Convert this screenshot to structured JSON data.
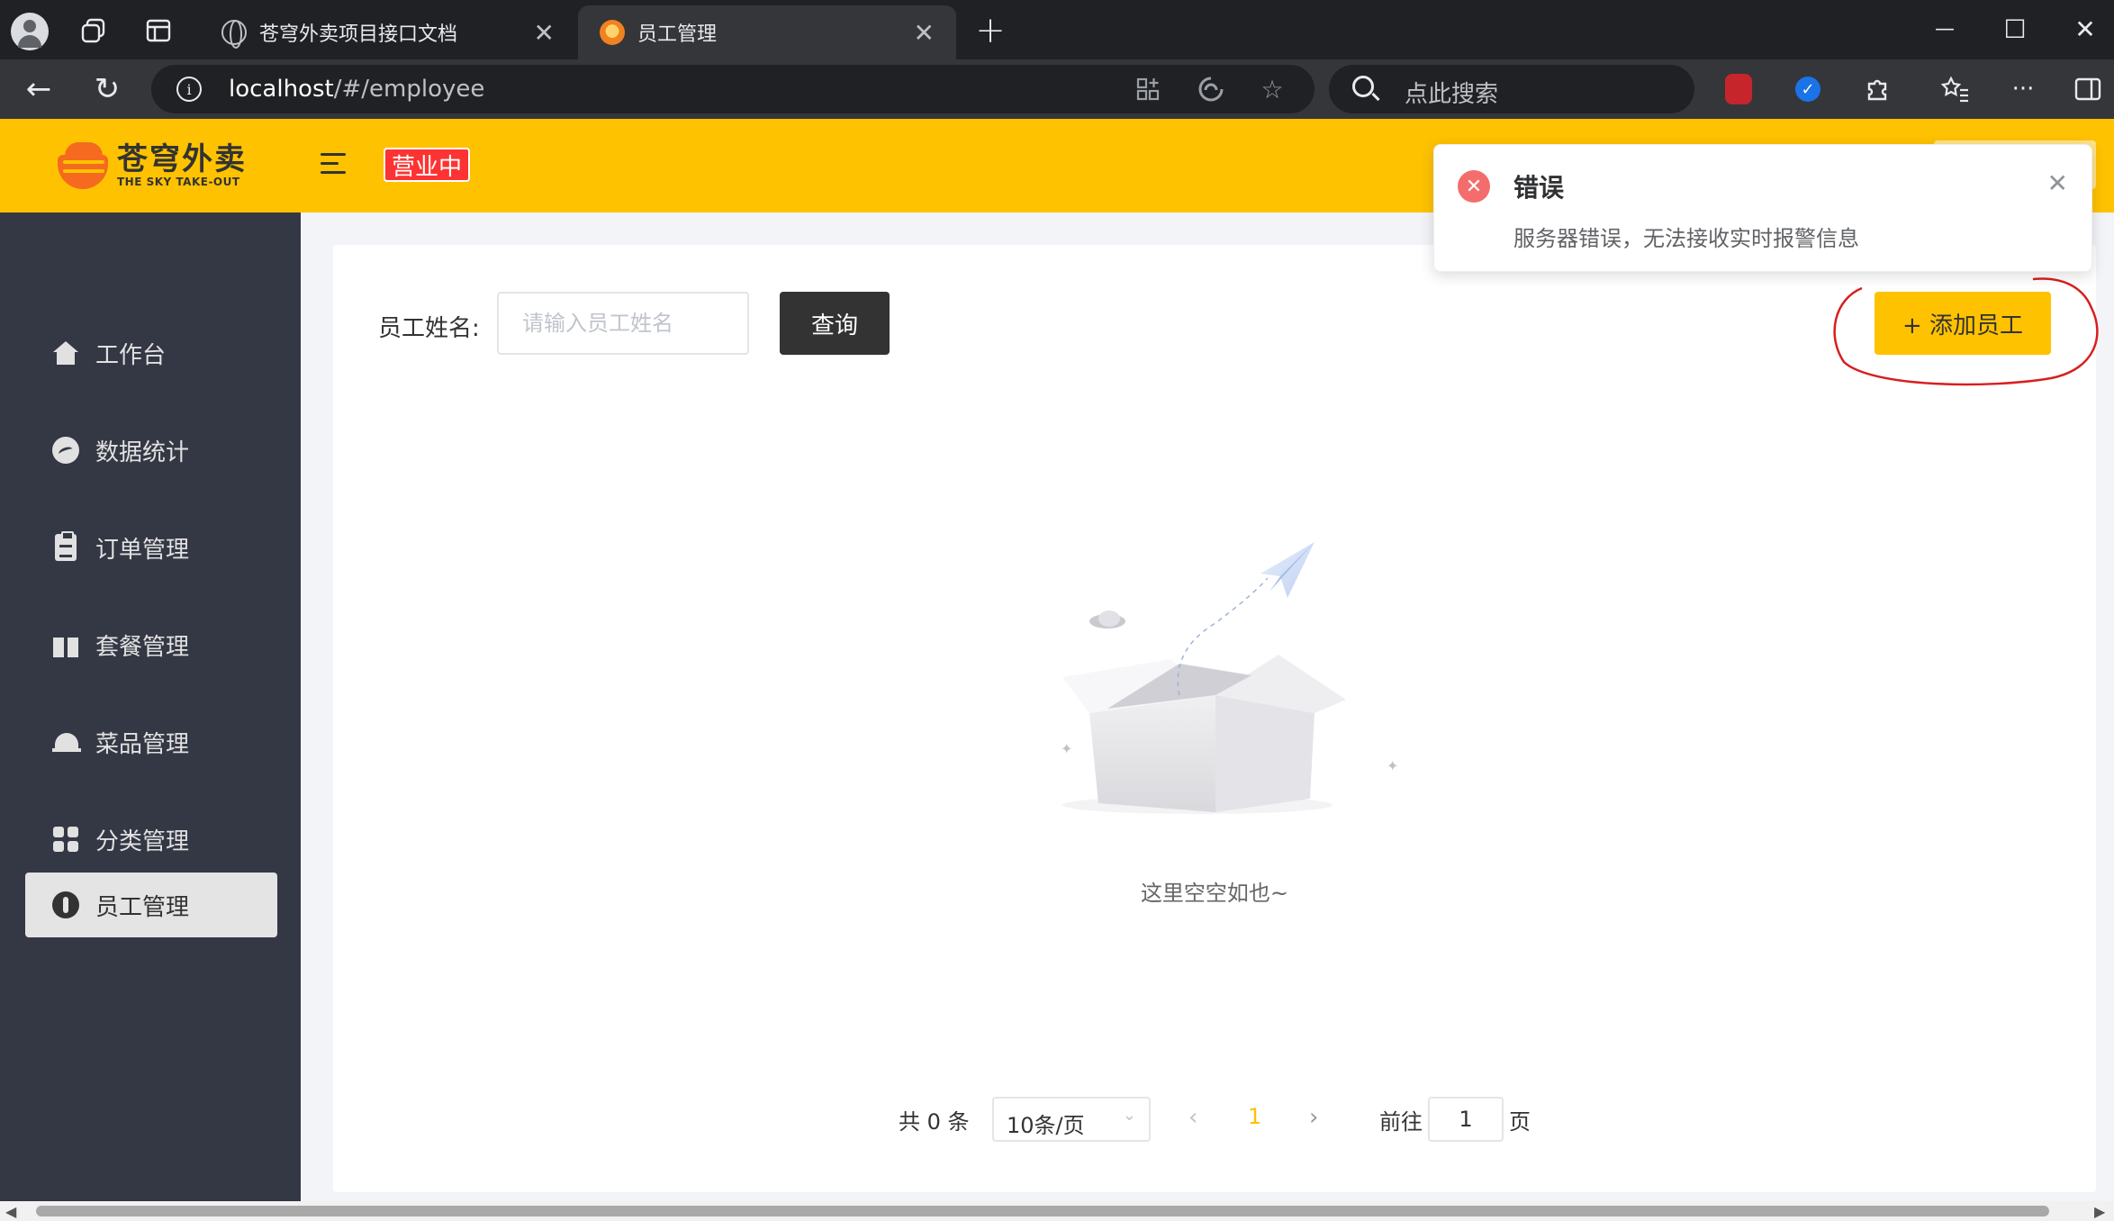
{
  "browser": {
    "tabs": [
      {
        "title": "苍穹外卖项目接口文档",
        "active": false
      },
      {
        "title": "员工管理",
        "active": true
      }
    ],
    "url_host": "localhost",
    "url_path": "/#/employee",
    "search_placeholder": "点此搜索",
    "icons": {
      "new_tab": "+",
      "close": "✕",
      "back": "←",
      "reload": "↻",
      "minimize": "—",
      "maximize": "☐",
      "window_close": "✕",
      "favorites": "☆",
      "more": "···"
    }
  },
  "header": {
    "logo_cn": "苍穹外卖",
    "logo_en": "THE SKY TAKE-OUT",
    "status_tag": "营业中",
    "brand_color": "#ffc200",
    "status_color": "#fd3333"
  },
  "sidebar": {
    "items": [
      {
        "label": "工作台",
        "icon": "home-icon",
        "active": false
      },
      {
        "label": "数据统计",
        "icon": "chart-circle-icon",
        "active": false
      },
      {
        "label": "订单管理",
        "icon": "clipboard-icon",
        "active": false
      },
      {
        "label": "套餐管理",
        "icon": "gift-icon",
        "active": false
      },
      {
        "label": "菜品管理",
        "icon": "food-cover-icon",
        "active": false
      },
      {
        "label": "分类管理",
        "icon": "grid-icon",
        "active": false
      },
      {
        "label": "员工管理",
        "icon": "person-icon",
        "active": true
      }
    ]
  },
  "main": {
    "filter_label": "员工姓名:",
    "filter_placeholder": "请输入员工姓名",
    "query_button": "查询",
    "add_button": "+ 添加员工",
    "empty_text": "这里空空如也~"
  },
  "pagination": {
    "total_text": "共 0 条",
    "page_size": "10条/页",
    "prev": "‹",
    "current_page": "1",
    "next": "›",
    "goto_label": "前往",
    "goto_value": "1",
    "page_word": "页"
  },
  "notification": {
    "type": "error",
    "title": "错误",
    "message": "服务器错误，无法接收实时报警信息",
    "close": "✕",
    "icon_char": "✕"
  }
}
